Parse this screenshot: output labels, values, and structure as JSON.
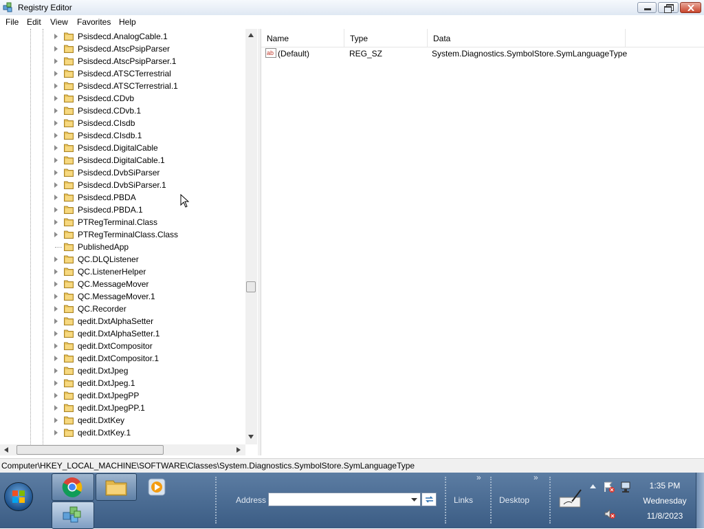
{
  "window": {
    "title": "Registry Editor",
    "buttons": [
      "minimize",
      "maximize",
      "close"
    ]
  },
  "menu": [
    "File",
    "Edit",
    "View",
    "Favorites",
    "Help"
  ],
  "tree": {
    "items": [
      {
        "label": "Psisdecd.AnalogCable.1",
        "expandable": true
      },
      {
        "label": "Psisdecd.AtscPsipParser",
        "expandable": true
      },
      {
        "label": "Psisdecd.AtscPsipParser.1",
        "expandable": true
      },
      {
        "label": "Psisdecd.ATSCTerrestrial",
        "expandable": true
      },
      {
        "label": "Psisdecd.ATSCTerrestrial.1",
        "expandable": true
      },
      {
        "label": "Psisdecd.CDvb",
        "expandable": true
      },
      {
        "label": "Psisdecd.CDvb.1",
        "expandable": true
      },
      {
        "label": "Psisdecd.CIsdb",
        "expandable": true
      },
      {
        "label": "Psisdecd.CIsdb.1",
        "expandable": true
      },
      {
        "label": "Psisdecd.DigitalCable",
        "expandable": true
      },
      {
        "label": "Psisdecd.DigitalCable.1",
        "expandable": true
      },
      {
        "label": "Psisdecd.DvbSiParser",
        "expandable": true
      },
      {
        "label": "Psisdecd.DvbSiParser.1",
        "expandable": true
      },
      {
        "label": "Psisdecd.PBDA",
        "expandable": true
      },
      {
        "label": "Psisdecd.PBDA.1",
        "expandable": true
      },
      {
        "label": "PTRegTerminal.Class",
        "expandable": true
      },
      {
        "label": "PTRegTerminalClass.Class",
        "expandable": true
      },
      {
        "label": "PublishedApp",
        "expandable": false
      },
      {
        "label": "QC.DLQListener",
        "expandable": true
      },
      {
        "label": "QC.ListenerHelper",
        "expandable": true
      },
      {
        "label": "QC.MessageMover",
        "expandable": true
      },
      {
        "label": "QC.MessageMover.1",
        "expandable": true
      },
      {
        "label": "QC.Recorder",
        "expandable": true
      },
      {
        "label": "qedit.DxtAlphaSetter",
        "expandable": true
      },
      {
        "label": "qedit.DxtAlphaSetter.1",
        "expandable": true
      },
      {
        "label": "qedit.DxtCompositor",
        "expandable": true
      },
      {
        "label": "qedit.DxtCompositor.1",
        "expandable": true
      },
      {
        "label": "qedit.DxtJpeg",
        "expandable": true
      },
      {
        "label": "qedit.DxtJpeg.1",
        "expandable": true
      },
      {
        "label": "qedit.DxtJpegPP",
        "expandable": true
      },
      {
        "label": "qedit.DxtJpegPP.1",
        "expandable": true
      },
      {
        "label": "qedit.DxtKey",
        "expandable": true
      },
      {
        "label": "qedit.DxtKey.1",
        "expandable": true
      }
    ]
  },
  "values": {
    "columns": [
      "Name",
      "Type",
      "Data"
    ],
    "rows": [
      {
        "name": "(Default)",
        "type": "REG_SZ",
        "data": "System.Diagnostics.SymbolStore.SymLanguageType"
      }
    ]
  },
  "status": {
    "path": "Computer\\HKEY_LOCAL_MACHINE\\SOFTWARE\\Classes\\System.Diagnostics.SymbolStore.SymLanguageType"
  },
  "taskbar": {
    "address_label": "Address",
    "address_value": "",
    "links_label": "Links",
    "desktop_label": "Desktop",
    "time": "1:35 PM",
    "day": "Wednesday",
    "date": "11/8/2023",
    "apps": [
      "chrome-icon",
      "file-explorer-icon",
      "media-player-icon",
      "registry-editor-icon"
    ]
  },
  "colors": {
    "taskbar": "#4a6d96",
    "folder": "#e8c25a",
    "close": "#c8452c"
  }
}
